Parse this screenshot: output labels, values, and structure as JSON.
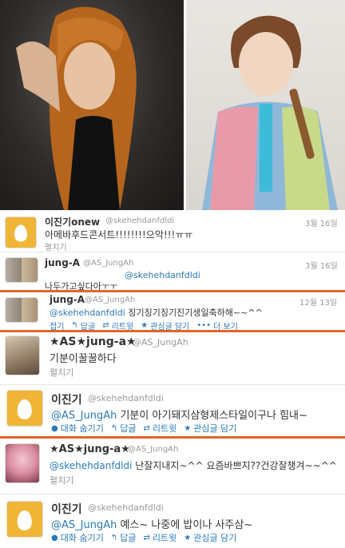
{
  "tweets": [
    {
      "name": "이진기onew",
      "handle": "@skehehdanfdldi",
      "date": "3월 16일",
      "text": "아메바후드콘서트!!!!!!!!으악!!!ㅠㅠ",
      "expand": "펼치기"
    },
    {
      "name": "jung-A",
      "handle": "@AS_JungAh",
      "date": "3월 16일",
      "mention": "@skehehdanfdldi",
      "text": "나두가고싶다아ㅜㅜ"
    },
    {
      "name": "jung-A",
      "handle": "@AS_JungAh",
      "date": "12월 13일",
      "mention": "@skehehdanfdldi",
      "text": " 징기징기징기진기생일축하해~~^^",
      "actions": [
        "접기",
        "답글",
        "리트윗",
        "관심글 담기",
        "더 보기"
      ]
    },
    {
      "name": "★AS★jung-a★",
      "handle": "@AS_JungAh",
      "text": "기분이꿀꿀하다",
      "expand": "펼치기"
    },
    {
      "name": "이진기",
      "handle": "@skehehdanfdldi",
      "mention": "@AS_JungAh",
      "text": " 기분이 아기돼지삼형제스타일이구나 힘내~",
      "actions": [
        "대화 숨기기",
        "답글",
        "리트윗",
        "관심글 담기"
      ]
    },
    {
      "name": "★AS★jung-a★",
      "handle": "@AS_JungAh",
      "mention": "@skehehdanfdldi",
      "text": " 난잘지내지~^^ 요즘바쁘지??건강잘챙겨~~^^",
      "expand": "펼치기"
    },
    {
      "name": "이진기",
      "handle": "@skehehdanfdldi",
      "mention": "@AS_JungAh",
      "text": " 예스~ 나중에 밥이나 사주삼~",
      "actions": [
        "대화 숨기기",
        "답글",
        "리트윗",
        "관심글 담기"
      ]
    }
  ],
  "icons": {
    "reply": "reply-icon",
    "retweet": "retweet-icon",
    "favorite": "star-icon",
    "more": "more-dots-icon",
    "conversation": "conversation-icon"
  },
  "colors": {
    "accent_line": "#e3652b",
    "link": "#2a7ab8",
    "egg_avatar": "#f0b537"
  }
}
